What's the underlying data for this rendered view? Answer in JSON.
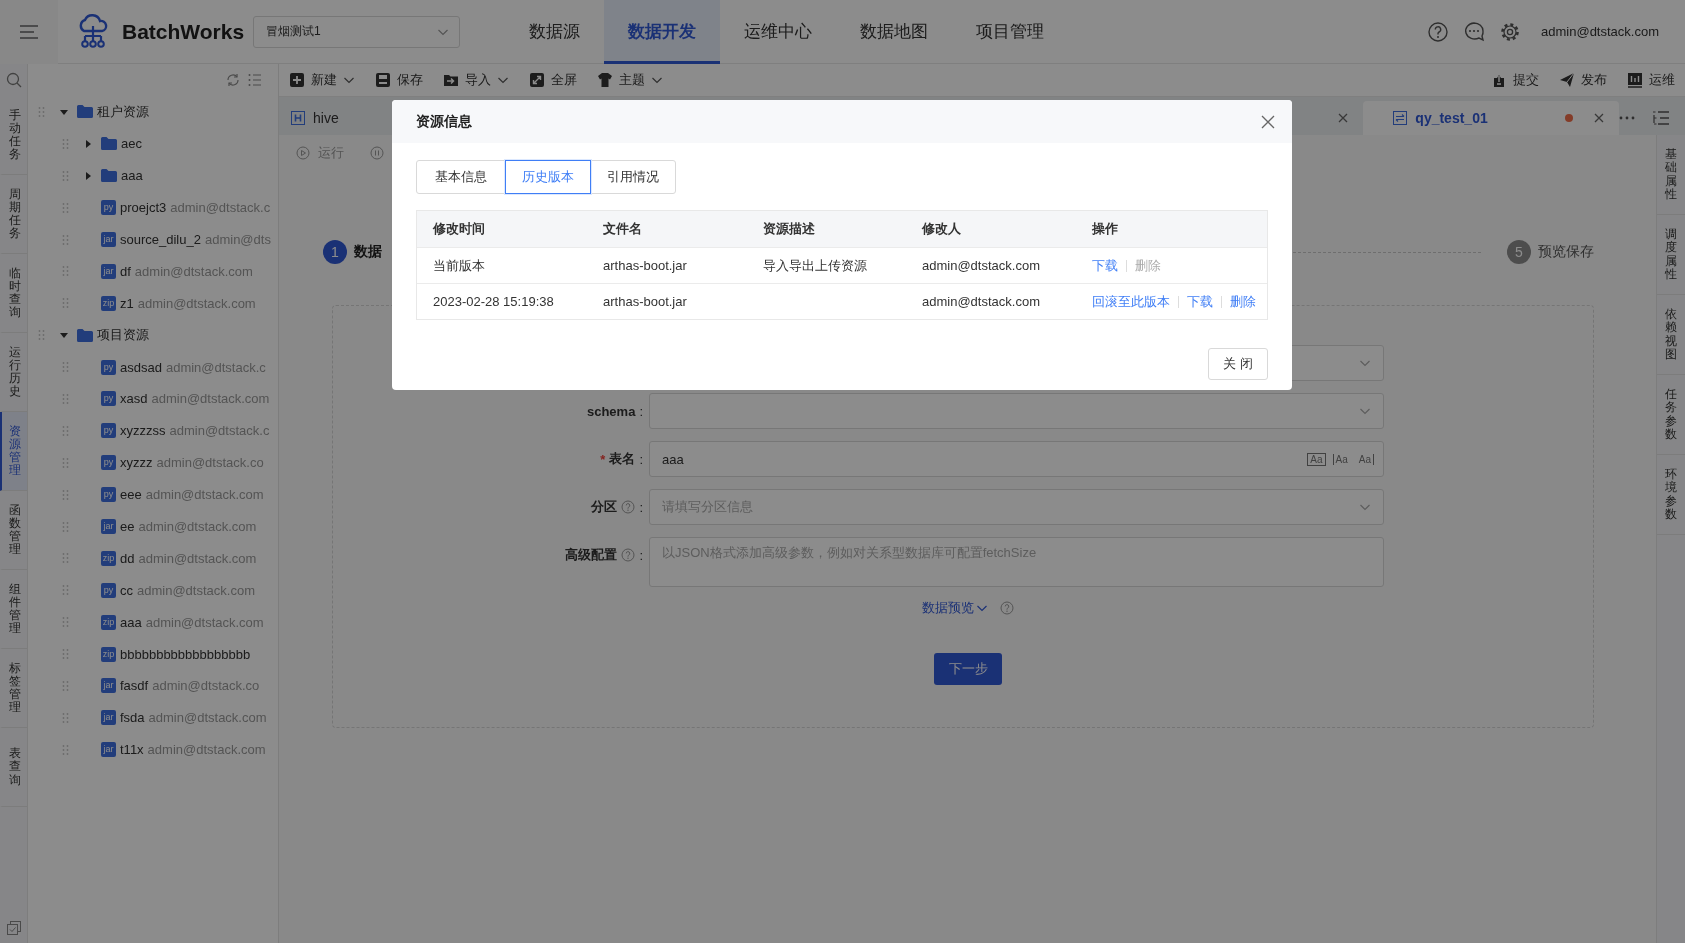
{
  "header": {
    "logo": "BatchWorks",
    "project": "冒烟测试1",
    "user": "admin@dtstack.com",
    "nav": [
      {
        "label": "数据源",
        "selected": false
      },
      {
        "label": "数据开发",
        "selected": true
      },
      {
        "label": "运维中心",
        "selected": false
      },
      {
        "label": "数据地图",
        "selected": false
      },
      {
        "label": "项目管理",
        "selected": false
      }
    ]
  },
  "left_rail": {
    "tabs": [
      {
        "label": "手动任务",
        "selected": false
      },
      {
        "label": "周期任务",
        "selected": false
      },
      {
        "label": "临时查询",
        "selected": false
      },
      {
        "label": "运行历史",
        "selected": false
      },
      {
        "label": "资源管理",
        "selected": true
      },
      {
        "label": "函数管理",
        "selected": false
      },
      {
        "label": "组件管理",
        "selected": false
      },
      {
        "label": "标签管理",
        "selected": false
      },
      {
        "label": "表查询",
        "selected": false
      }
    ]
  },
  "resource_tree": {
    "items": [
      {
        "kind": "folder",
        "label": "租户资源",
        "expanded": true,
        "children": [
          {
            "kind": "folder",
            "label": "aec",
            "expanded": false
          },
          {
            "kind": "folder",
            "label": "aaa",
            "expanded": false
          },
          {
            "kind": "file",
            "badge": "py",
            "label": "proejct3",
            "owner": "admin@dtstack.c"
          },
          {
            "kind": "file",
            "badge": "jar",
            "label": "source_dilu_2",
            "owner": "admin@dts"
          },
          {
            "kind": "file",
            "badge": "jar",
            "label": "df",
            "owner": "admin@dtstack.com"
          },
          {
            "kind": "file",
            "badge": "zip",
            "label": "z1",
            "owner": "admin@dtstack.com"
          }
        ]
      },
      {
        "kind": "folder",
        "label": "项目资源",
        "expanded": true,
        "children": [
          {
            "kind": "file",
            "badge": "py",
            "label": "asdsad",
            "owner": "admin@dtstack.c"
          },
          {
            "kind": "file",
            "badge": "py",
            "label": "xasd",
            "owner": "admin@dtstack.com"
          },
          {
            "kind": "file",
            "badge": "py",
            "label": "xyzzzss",
            "owner": "admin@dtstack.c"
          },
          {
            "kind": "file",
            "badge": "py",
            "label": "xyzzz",
            "owner": "admin@dtstack.co"
          },
          {
            "kind": "file",
            "badge": "py",
            "label": "eee",
            "owner": "admin@dtstack.com"
          },
          {
            "kind": "file",
            "badge": "jar",
            "label": "ee",
            "owner": "admin@dtstack.com"
          },
          {
            "kind": "file",
            "badge": "zip",
            "label": "dd",
            "owner": "admin@dtstack.com"
          },
          {
            "kind": "file",
            "badge": "py",
            "label": "cc",
            "owner": "admin@dtstack.com"
          },
          {
            "kind": "file",
            "badge": "zip",
            "label": "aaa",
            "owner": "admin@dtstack.com"
          },
          {
            "kind": "file",
            "badge": "zip",
            "label": "bbbbbbbbbbbbbbbbbb"
          },
          {
            "kind": "file",
            "badge": "jar",
            "label": "fasdf",
            "owner": "admin@dtstack.co"
          },
          {
            "kind": "file",
            "badge": "jar",
            "label": "fsda",
            "owner": "admin@dtstack.com"
          },
          {
            "kind": "file",
            "badge": "jar",
            "label": "t11x",
            "owner": "admin@dtstack.com"
          }
        ]
      }
    ]
  },
  "toolbar": {
    "left": [
      {
        "label": "新建",
        "dropdown": true
      },
      {
        "label": "保存",
        "dropdown": false
      },
      {
        "label": "导入",
        "dropdown": true
      },
      {
        "label": "全屏",
        "dropdown": false
      },
      {
        "label": "主题",
        "dropdown": true
      }
    ],
    "right": [
      {
        "label": "提交"
      },
      {
        "label": "发布"
      },
      {
        "label": "运维"
      }
    ]
  },
  "editor_tabs": [
    {
      "label": "hive",
      "selected": false,
      "modified": false
    },
    {
      "label": "qy_test_01",
      "selected": true,
      "modified": true
    }
  ],
  "run_bar": {
    "run": "运行"
  },
  "steps": [
    {
      "number": "1",
      "label": "数据",
      "active": true
    },
    {
      "number": "5",
      "label": "预览保存",
      "active": false
    }
  ],
  "form": {
    "fields": [
      {
        "kind": "select"
      },
      {
        "kind": "select",
        "label": "schema",
        "colon": ":"
      },
      {
        "kind": "text",
        "label": "表名",
        "required_mark": "*",
        "colon": ":",
        "value": "aaa",
        "tools": [
          "Aa",
          "Aa",
          "Aa"
        ]
      },
      {
        "kind": "select",
        "label": "分区",
        "help": true,
        "colon": ":",
        "placeholder": "请填写分区信息"
      },
      {
        "kind": "textarea",
        "label": "高级配置",
        "help": true,
        "colon": ":",
        "placeholder": "以JSON格式添加高级参数，例如对关系型数据库可配置fetchSize"
      }
    ],
    "preview_link": "数据预览",
    "next_button": "下一步"
  },
  "right_rail": {
    "tabs": [
      "基础属性",
      "调度属性",
      "依赖视图",
      "任务参数",
      "环境参数"
    ]
  },
  "modal": {
    "title": "资源信息",
    "tabs": [
      {
        "label": "基本信息",
        "selected": false
      },
      {
        "label": "历史版本",
        "selected": true
      },
      {
        "label": "引用情况",
        "selected": false
      }
    ],
    "table": {
      "columns": [
        "修改时间",
        "文件名",
        "资源描述",
        "修改人",
        "操作"
      ],
      "rows": [
        {
          "cells": [
            "当前版本",
            "arthas-boot.jar",
            "导入导出上传资源",
            "admin@dtstack.com"
          ],
          "actions": [
            {
              "label": "下载",
              "disabled": false
            },
            {
              "label": "删除",
              "disabled": true
            }
          ]
        },
        {
          "cells": [
            "2023-02-28 15:19:38",
            "arthas-boot.jar",
            "",
            "admin@dtstack.com"
          ],
          "actions": [
            {
              "label": "回滚至此版本",
              "disabled": false
            },
            {
              "label": "下载",
              "disabled": false
            },
            {
              "label": "删除",
              "disabled": false
            }
          ]
        }
      ]
    },
    "close_button": "关 闭"
  }
}
